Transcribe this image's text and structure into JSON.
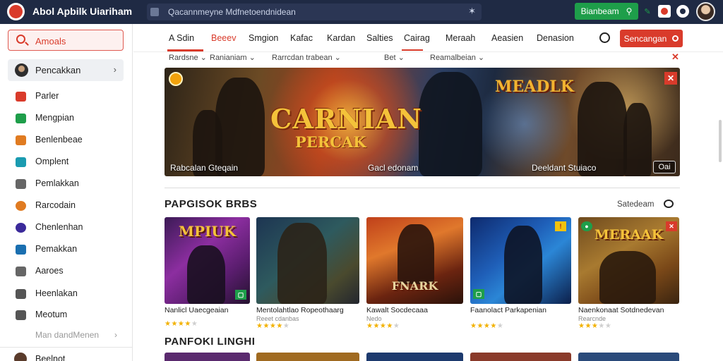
{
  "app": {
    "title": "Abol Apbilk Uiariham"
  },
  "url_bar": {
    "text": "Qacannmeyne Mdfnetoendnidean"
  },
  "header_button": {
    "label": "Bianbeam"
  },
  "sidebar": {
    "search_label": "Amoals",
    "active_item": "Pencakkan",
    "items": [
      {
        "label": "Parler",
        "icon": "flag-icon",
        "color": "#d93b2b"
      },
      {
        "label": "Mengpian",
        "icon": "chart-icon",
        "color": "#1e9e4a"
      },
      {
        "label": "Benlenbeae",
        "icon": "grid-icon",
        "color": "#e07b21"
      },
      {
        "label": "Omplent",
        "icon": "tv-icon",
        "color": "#1a9bb0"
      },
      {
        "label": "Pemlakkan",
        "icon": "document-icon",
        "color": "#666666"
      },
      {
        "label": "Rarcodain",
        "icon": "avatar-icon",
        "color": "#e07b21"
      },
      {
        "label": "Chenlenhan",
        "icon": "circle-icon",
        "color": "#3b2a9a"
      },
      {
        "label": "Pemakkan",
        "icon": "calendar-icon",
        "color": "#1a6fb0"
      },
      {
        "label": "Aaroes",
        "icon": "chart-icon",
        "color": "#666666"
      },
      {
        "label": "Heenlakan",
        "icon": "document-icon",
        "color": "#555555"
      },
      {
        "label": "Meotum",
        "icon": "document-icon",
        "color": "#555555"
      }
    ],
    "more_label": "Man dandMenen",
    "bottom_item": "Beelnot"
  },
  "tabs": {
    "items": [
      "A Sdin",
      "Beeev",
      "Smgion",
      "Kafac",
      "Kardan",
      "Salties",
      "Cairag",
      "Meraah",
      "Aeasien",
      "Denasion"
    ],
    "active_index": 1,
    "cta_label": "Sencangan"
  },
  "filters": [
    "Rardsne",
    "Ranianiam",
    "Rarrcdan trabean",
    "Bet",
    "Reamalbeian"
  ],
  "hero": {
    "logo": "CARNIAN",
    "logo_sub": "PERCAK",
    "logo2": "MEADLK",
    "captions": [
      "Rabcalan Gteqain",
      "Gacl edonam",
      "Deeldant Stuiaco"
    ],
    "button_label": "Oai"
  },
  "section1": {
    "title": "PAPGISOK BRBS",
    "action_label": "Satedeam",
    "cards": [
      {
        "art_text": "MPIUK",
        "name": "Nanlicl Uaecgeaian",
        "sub": "",
        "rating": 4
      },
      {
        "art_text": "",
        "name": "Mentolahtlao Ropeothaarg",
        "sub": "Reeet cdanbas",
        "rating": 4
      },
      {
        "art_text": "FNARK",
        "name": "Kawalt Socdecaaa",
        "sub": "Nedo",
        "rating": 4
      },
      {
        "art_text": "",
        "name": "Faanolact Parkapenian",
        "sub": "",
        "rating": 4
      },
      {
        "art_text": "MERAAK",
        "name": "Naenkonaat Sotdnedevan",
        "sub": "Rearcnde",
        "rating": 3
      }
    ]
  },
  "section2": {
    "title": "PANFOKI LINGHI"
  },
  "colors": {
    "accent": "#d93b2b",
    "topbar": "#1f2a44",
    "success": "#1e9e4a"
  }
}
